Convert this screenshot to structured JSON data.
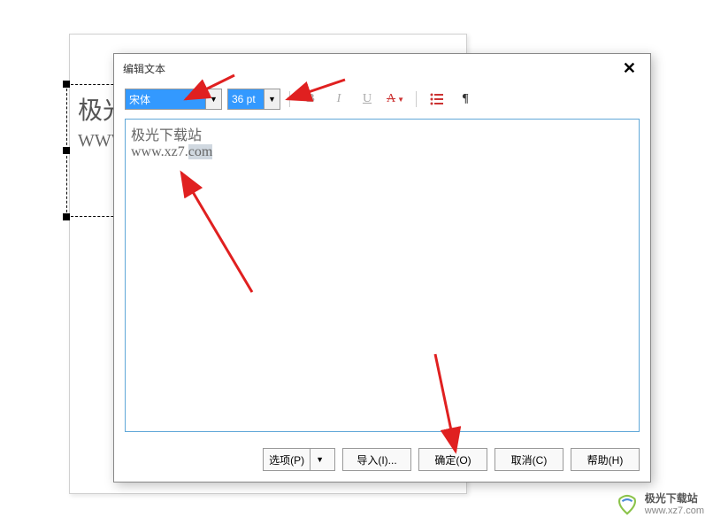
{
  "document": {
    "line1": "极光",
    "line2": "WWW"
  },
  "dialog": {
    "title": "编辑文本",
    "font_name": "宋体",
    "font_size": "36 pt",
    "content_line1": "极光下载站",
    "content_line2_a": "www.xz7.",
    "content_line2_b": "com",
    "buttons": {
      "options": "选项(P)",
      "import": "导入(I)...",
      "ok": "确定(O)",
      "cancel": "取消(C)",
      "help": "帮助(H)"
    },
    "toolbar": {
      "bold": "B",
      "italic": "I",
      "underline": "U",
      "color": "A",
      "list": "☰",
      "para": "¶"
    }
  },
  "watermark": {
    "name": "极光下载站",
    "url": "www.xz7.com"
  },
  "icons": {
    "close": "✕",
    "dropdown": "▼",
    "font_color_underline": "▬"
  }
}
